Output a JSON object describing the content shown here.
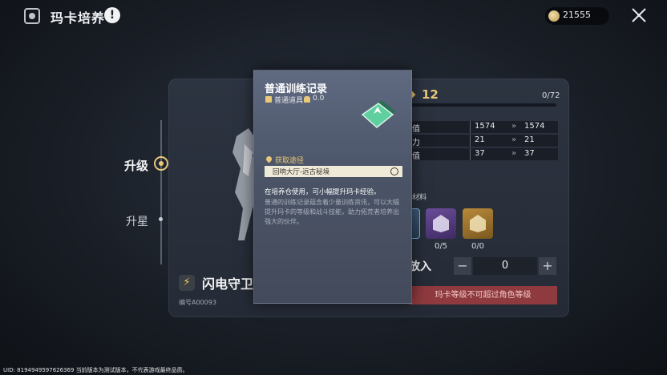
{
  "header": {
    "title": "玛卡培养",
    "info_icon": "info-icon",
    "currency": "21555",
    "currency_icon": "coin-icon",
    "close_icon": "close-icon"
  },
  "tabs": {
    "upgrade": "升级",
    "star": "升星"
  },
  "card": {
    "name": "闪电守卫号",
    "id": "编号A00093"
  },
  "stats": {
    "level": "12",
    "exp": "0/72",
    "rows": [
      {
        "label": "值",
        "from": "1574",
        "to": "1574"
      },
      {
        "label": "力",
        "from": "21",
        "to": "21"
      },
      {
        "label": "值",
        "from": "37",
        "to": "37"
      }
    ]
  },
  "materials": {
    "label": "材料",
    "items": [
      {
        "count": ""
      },
      {
        "count": "0/5"
      },
      {
        "count": "0/0"
      }
    ]
  },
  "controls": {
    "put_label": "放入",
    "minus": "−",
    "qty": "0",
    "plus": "+",
    "warning": "玛卡等级不可超过角色等级"
  },
  "tooltip": {
    "title": "普通训练记录",
    "type": "普通道具",
    "weight": "0.0",
    "source_label": "获取途径",
    "source": "回响大厅-远古秘境",
    "usage": "在培养仓使用，可小幅提升玛卡经验。",
    "description": "普通的训练记录蕴含着少量训练资讯，可以大幅提升玛卡的等级和战斗技能，助力拓荒者培养出强大的伙伴。"
  },
  "footer": {
    "uid": "UID: 8194949597626369 当前版本为测试版本，不代表游戏最终品质。"
  },
  "colors": {
    "accent_gold": "#e8c97a",
    "warning_bg": "#8e3a3e"
  }
}
